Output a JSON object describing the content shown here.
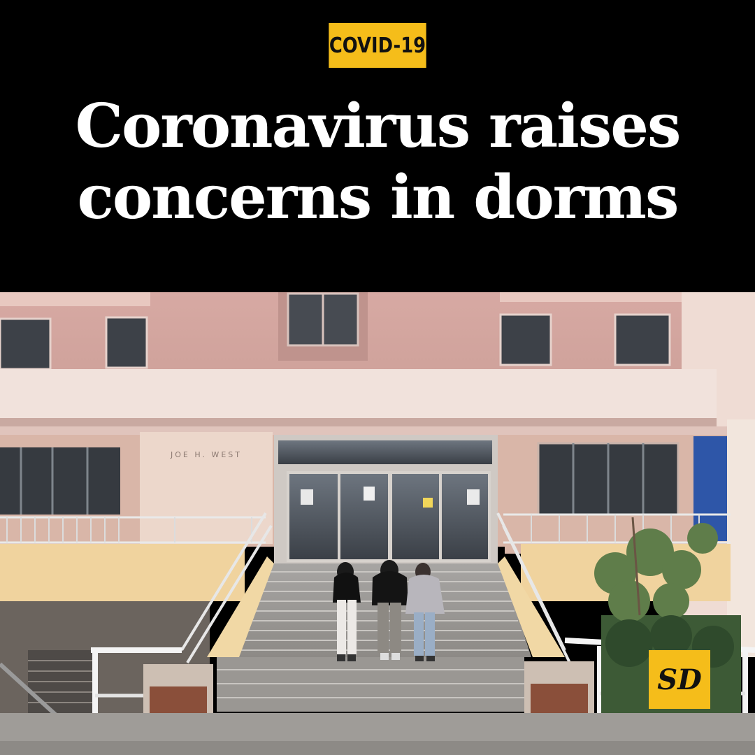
{
  "tag": "COVID-19",
  "headline": {
    "line1": "Coronavirus raises",
    "line2": "concerns in dorms"
  },
  "building_sign": "JOE H. WEST",
  "logo": "SD",
  "colors": {
    "accent": "#f5bd1a",
    "header_bg": "#000000",
    "headline_text": "#ffffff"
  }
}
